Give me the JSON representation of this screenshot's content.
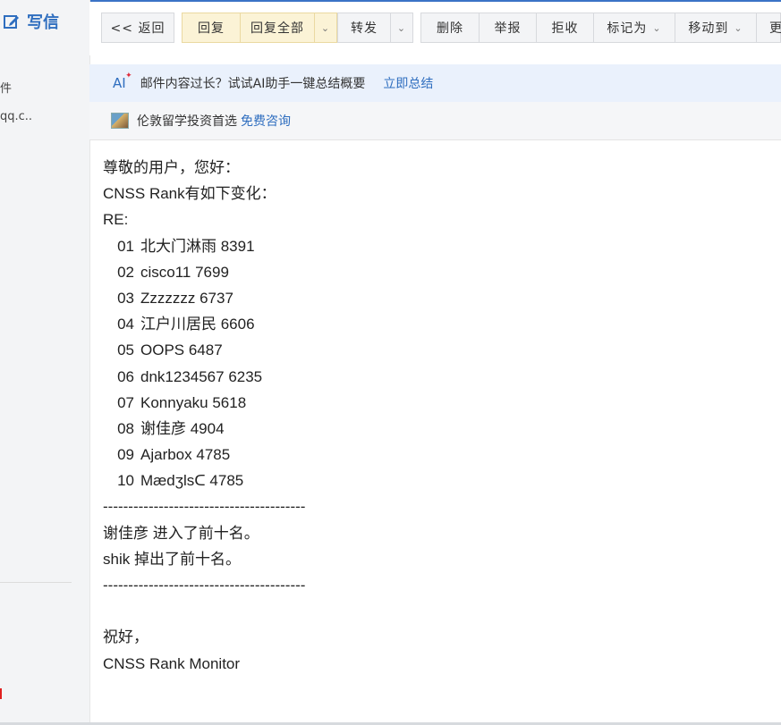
{
  "sidebar": {
    "compose_label": "写信",
    "fragment_1": "件",
    "fragment_2": "qq.c.."
  },
  "toolbar": {
    "back": "<< 返回",
    "reply": "回复",
    "reply_all": "回复全部",
    "forward": "转发",
    "delete": "删除",
    "report": "举报",
    "reject": "拒收",
    "mark_as": "标记为",
    "move_to": "移动到",
    "more": "更"
  },
  "ai_banner": {
    "logo": "AI",
    "text": "邮件内容过长？试试AI助手一键总结概要",
    "link": "立即总结"
  },
  "ad": {
    "text": "伦敦留学投资首选",
    "link": "免费咨询"
  },
  "email": {
    "greeting": "尊敬的用户，您好：",
    "intro": "CNSS Rank有如下变化：",
    "re": "RE:",
    "ranking": [
      {
        "num": "01",
        "entry": "北大门淋雨 8391"
      },
      {
        "num": "02",
        "entry": "cisco11 7699"
      },
      {
        "num": "03",
        "entry": "Zzzzzzz 6737"
      },
      {
        "num": "04",
        "entry": "江户川居民 6606"
      },
      {
        "num": "05",
        "entry": "OOPS 6487"
      },
      {
        "num": "06",
        "entry": "dnk1234567 6235"
      },
      {
        "num": "07",
        "entry": "Konnyaku 5618"
      },
      {
        "num": "08",
        "entry": "谢佳彦 4904"
      },
      {
        "num": "09",
        "entry": "Ajarbox 4785"
      },
      {
        "num": "10",
        "entry": "Mædʒlsᑕ 4785"
      }
    ],
    "separator": "----------------------------------------",
    "change_1": "谢佳彦 进入了前十名。",
    "change_2": "shik 掉出了前十名。",
    "closing": "祝好，",
    "signature": "CNSS Rank Monitor"
  }
}
